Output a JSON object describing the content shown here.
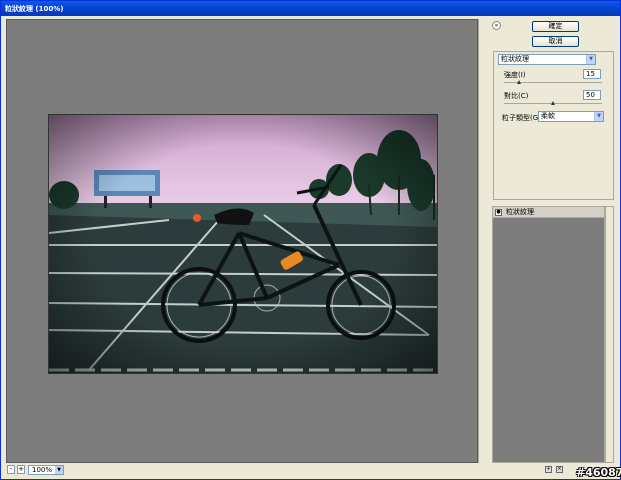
{
  "window": {
    "title": "粒狀紋理 (100%)"
  },
  "buttons": {
    "ok_label": "確定",
    "cancel_label": "取消",
    "collapse_glyph": "»"
  },
  "filter": {
    "name": "粒狀紋理",
    "intensity_label": "強度(I)",
    "intensity_value": "15",
    "intensity_fraction": 0.15,
    "contrast_label": "對比(C)",
    "contrast_value": "50",
    "contrast_fraction": 0.5,
    "grain_type_label": "粒子類型(G):",
    "grain_type_value": "柔軟"
  },
  "layers": {
    "items": [
      {
        "name": "粒狀紋理"
      }
    ]
  },
  "bottom": {
    "zoom_value": "100%",
    "zoom_out": "-",
    "zoom_in": "+"
  },
  "watermark": "#46087",
  "icons": {
    "eye": "eye-icon",
    "new_layer": "new-layer-icon",
    "delete": "delete-layer-icon",
    "arrow": "chevron-down-icon"
  },
  "colors": {
    "accent": "#0846d4",
    "canvas": "#7d7d7d",
    "sky": "#d8b4d8"
  }
}
